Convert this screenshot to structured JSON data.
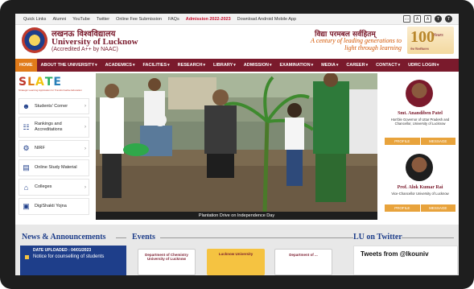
{
  "topbar": {
    "links": [
      "Quick Links",
      "Alumni",
      "YouTube",
      "Twitter",
      "Online Fee Submission",
      "FAQs",
      "Admission 2022-2023",
      "Download Android Mobile App"
    ]
  },
  "header": {
    "hindi_name": "लखनऊ विश्वविद्यालय",
    "english_name": "University of Lucknow",
    "accreditation": "(Accredited A++ by NAAC)",
    "tagline_hindi": "विद्या परमबल सर्वहितम्",
    "tagline_english": "A century of leading generations to light through learning",
    "centenary_number": "100",
    "centenary_label": "Years",
    "centenary_sub": "मेधा विश्वविद्यालय"
  },
  "nav": {
    "items": [
      "HOME",
      "ABOUT THE UNIVERSITY",
      "ACADEMICS",
      "FACILITIES",
      "RESEARCH",
      "LIBRARY",
      "ADMISSION",
      "EXAMINATION",
      "MEDIA",
      "CAREER",
      "CONTACT",
      "UDRC LOGIN"
    ]
  },
  "sidebar": {
    "slate_letters": [
      "S",
      "L",
      "A",
      "T",
      "E"
    ],
    "slate_sub": "Strategic Learning Application for Transformative Education",
    "items": [
      {
        "label": "Students' Corner",
        "icon": "students-icon"
      },
      {
        "label": "Rankings and Accreditations",
        "icon": "ranking-icon"
      },
      {
        "label": "NIRF",
        "icon": "nirf-icon"
      },
      {
        "label": "Online Study Material",
        "icon": "book-icon"
      },
      {
        "label": "Colleges",
        "icon": "college-icon"
      },
      {
        "label": "DigiShakti Yojna",
        "icon": "digishakti-icon"
      }
    ]
  },
  "slider": {
    "caption": "Plantation Drive on Independence Day"
  },
  "right_panel": {
    "people": [
      {
        "name": "Smt. Anandiben Patel",
        "role": "Hon'ble Governor of Uttar Pradesh and Chancellor, University of Lucknow",
        "btn1": "PROFILE",
        "btn2": "MESSAGE"
      },
      {
        "name": "Prof. Alok Kumar Rai",
        "role": "Vice-Chancellor University of Lucknow",
        "btn1": "PROFILE",
        "btn2": "MESSAGE"
      }
    ]
  },
  "bottom": {
    "news_title": "News & Announcements",
    "news_date": "DATE UPLOADED : 04/01/2023",
    "news_text": "Notice for counselling of students",
    "events_title": "Events",
    "event_cards": [
      "Department of Chemistry University of Lucknow",
      "Lucknow University",
      "Department of ..."
    ],
    "twitter_title": "LU on Twitter",
    "twitter_text": "Tweets from @lkouniv"
  },
  "colors": {
    "maroon": "#7a1a2c",
    "orange": "#e07b1a",
    "navy": "#1e3e8a",
    "gold": "#e8a33c"
  }
}
